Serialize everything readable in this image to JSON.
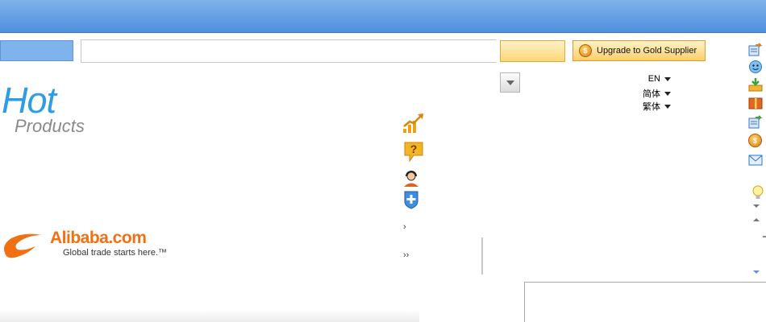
{
  "header": {
    "upgrade_label": "Upgrade to Gold Supplier"
  },
  "languages": [
    {
      "label": "EN"
    },
    {
      "label": "简体"
    },
    {
      "label": "繁体"
    }
  ],
  "hot_products": {
    "title": "Hot",
    "subtitle": "Products"
  },
  "side_links": {
    "next": "›",
    "last": "››"
  },
  "logo": {
    "name": "Alibaba.com",
    "tagline": "Global trade starts here.™"
  },
  "colors": {
    "topbar": "#5b97e0",
    "accent_blue": "#2d9ee6",
    "alibaba_orange": "#f07012",
    "gold_button": "#fbd06a"
  },
  "icons": [
    "trend-up-icon",
    "help-bubble-icon",
    "support-agent-icon",
    "shield-plus-icon",
    "forward-doc-icon",
    "face-icon",
    "download-inbox-icon",
    "gift-icon",
    "share-doc-icon",
    "gold-coin-icon",
    "mail-icon",
    "lightbulb-icon"
  ]
}
